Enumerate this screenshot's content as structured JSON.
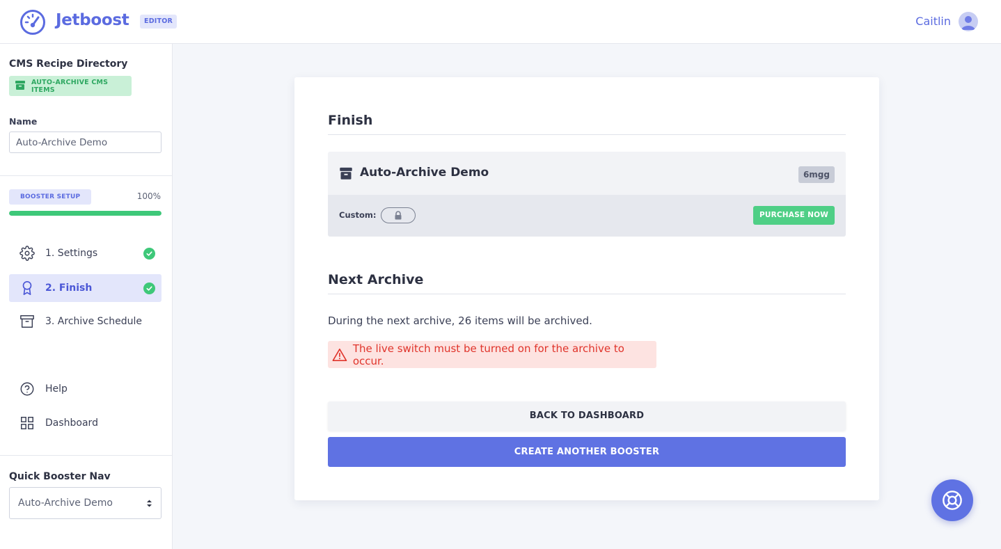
{
  "header": {
    "app_name": "Jetboost",
    "mode_badge": "EDITOR",
    "user_name": "Caitlin"
  },
  "sidebar": {
    "collection_title": "CMS Recipe Directory",
    "booster_type_badge": "AUTO-ARCHIVE CMS ITEMS",
    "name_label": "Name",
    "name_value": "Auto-Archive Demo",
    "setup_badge": "BOOSTER SETUP",
    "setup_percent_label": "100%",
    "setup_progress": 1.0,
    "steps": [
      {
        "label": "1. Settings",
        "icon": "gear-icon",
        "complete": true,
        "active": false
      },
      {
        "label": "2. Finish",
        "icon": "award-icon",
        "complete": true,
        "active": true
      },
      {
        "label": "3. Archive Schedule",
        "icon": "archive-icon",
        "complete": false,
        "active": false
      }
    ],
    "links": [
      {
        "label": "Help",
        "icon": "help-circle-icon"
      },
      {
        "label": "Dashboard",
        "icon": "grid-icon"
      }
    ],
    "quick_nav_title": "Quick Booster Nav",
    "quick_nav_selected": "Auto-Archive Demo"
  },
  "main": {
    "finish_title": "Finish",
    "booster": {
      "name": "Auto-Archive Demo",
      "code": "6mgg",
      "custom_label": "Custom:",
      "purchase_label": "PURCHASE NOW"
    },
    "next_archive_title": "Next Archive",
    "next_archive_text": "During the next archive, 26 items will be archived.",
    "alert_text": "The live switch must be turned on for the archive to occur.",
    "back_button": "BACK TO DASHBOARD",
    "create_button": "CREATE ANOTHER BOOSTER"
  },
  "colors": {
    "brand": "#5b6be0",
    "success": "#3ec879",
    "danger": "#e0342b"
  }
}
